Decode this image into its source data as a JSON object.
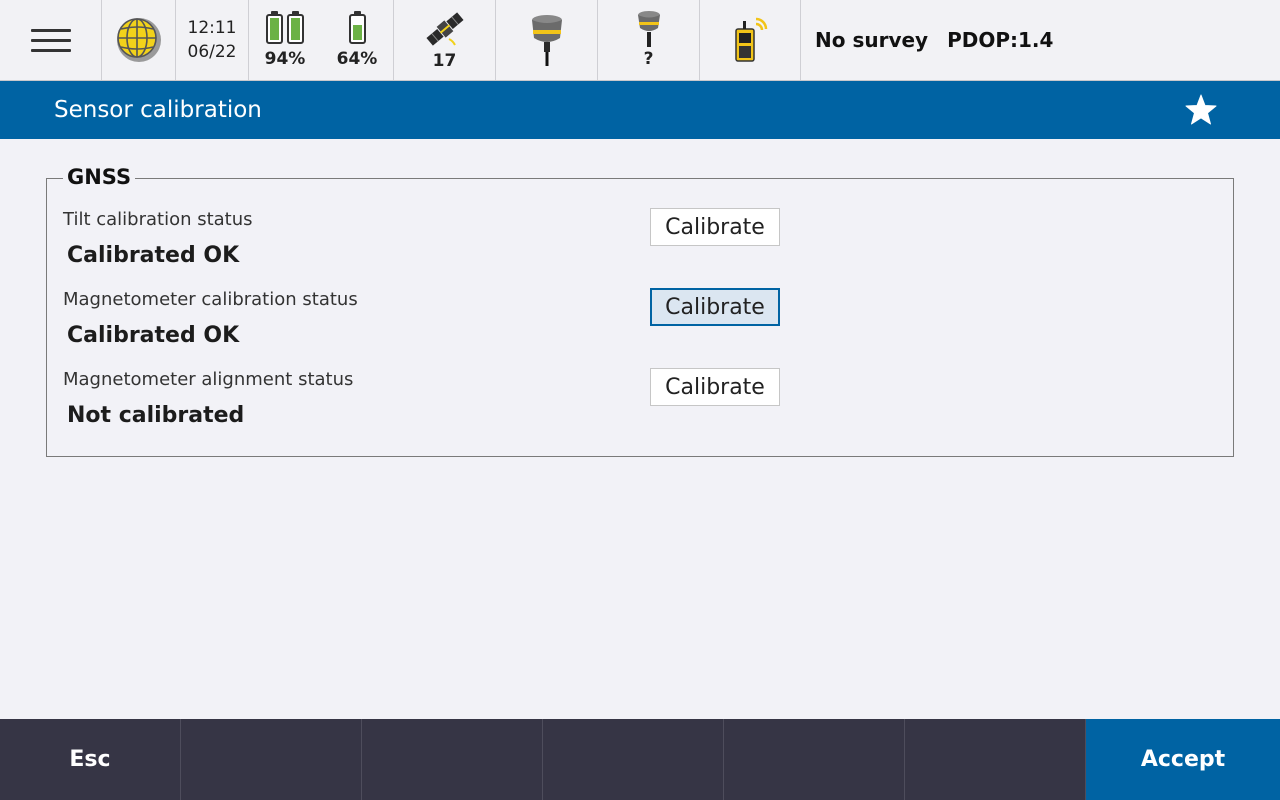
{
  "status_bar": {
    "time": "12:11",
    "date": "06/22",
    "battery_1_percent": "94%",
    "battery_2_percent": "64%",
    "battery_1_level": 0.94,
    "battery_2_level": 0.64,
    "satellites": "17",
    "receiver_2_status": "?",
    "survey_status": "No survey",
    "pdop": "PDOP:1.4",
    "icons": [
      "menu-icon",
      "globe-icon",
      "battery-icon",
      "satellite-icon",
      "gnss-receiver-icon",
      "gnss-receiver-small-icon",
      "controller-icon"
    ]
  },
  "title_bar": {
    "title": "Sensor calibration",
    "favorite_icon": "star-icon"
  },
  "gnss_group": {
    "legend": "GNSS",
    "rows": [
      {
        "label": "Tilt calibration status",
        "value": "Calibrated OK",
        "button": "Calibrate"
      },
      {
        "label": "Magnetometer calibration status",
        "value": "Calibrated OK",
        "button": "Calibrate"
      },
      {
        "label": "Magnetometer alignment status",
        "value": "Not calibrated",
        "button": "Calibrate"
      }
    ]
  },
  "softkeys": {
    "esc": "Esc",
    "key2": "",
    "key3": "",
    "key4": "",
    "key5": "",
    "key6": "",
    "accept": "Accept"
  },
  "colors": {
    "accent": "#0063a3",
    "bottom_bar": "#363545",
    "battery_fill": "#6cb245",
    "background": "#f2f2f7"
  }
}
